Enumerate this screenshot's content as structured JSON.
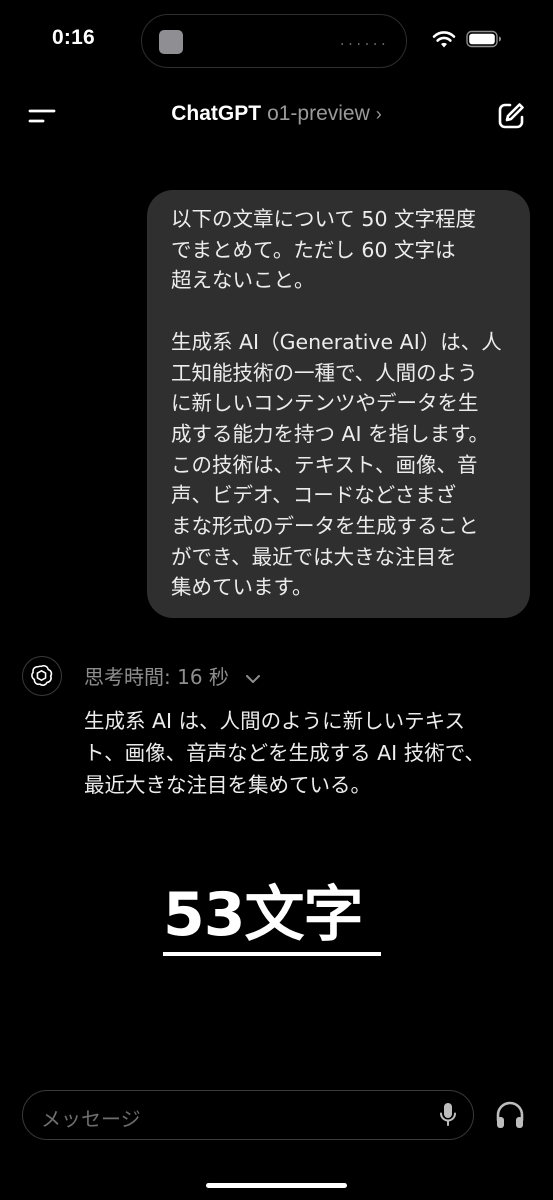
{
  "status_bar": {
    "time": "0:16",
    "island_dots": "......",
    "icons": [
      "wifi-icon",
      "battery-icon"
    ]
  },
  "header": {
    "app_name": "ChatGPT",
    "model_name": "o1-preview",
    "chevron": "›",
    "icons": [
      "menu-icon",
      "new-chat-icon"
    ]
  },
  "user_message": {
    "lines_part1": [
      "以下の文章について 50 文字程度",
      "でまとめて。ただし 60 文字は",
      "超えないこと。"
    ],
    "lines_part2": [
      "生成系 AI（Generative AI）は、人",
      "工知能技術の一種で、人間のよう",
      "に新しいコンテンツやデータを生",
      "成する能力を持つ AI を指します。",
      "この技術は、テキスト、画像、音",
      "声、ビデオ、コードなどさまざ",
      "まな形式のデータを生成すること",
      "ができ、最近では大きな注目を",
      "集めています。"
    ]
  },
  "assistant": {
    "thinking_label": "思考時間: 16 秒",
    "reply_lines": [
      "生成系 AI は、人間のように新しいテキス",
      "ト、画像、音声などを生成する AI 技術で、",
      "最近大きな注目を集めている。"
    ]
  },
  "annotation": {
    "text": "53文字"
  },
  "composer": {
    "placeholder": "メッセージ",
    "icons": [
      "mic-icon",
      "headphones-icon"
    ]
  }
}
